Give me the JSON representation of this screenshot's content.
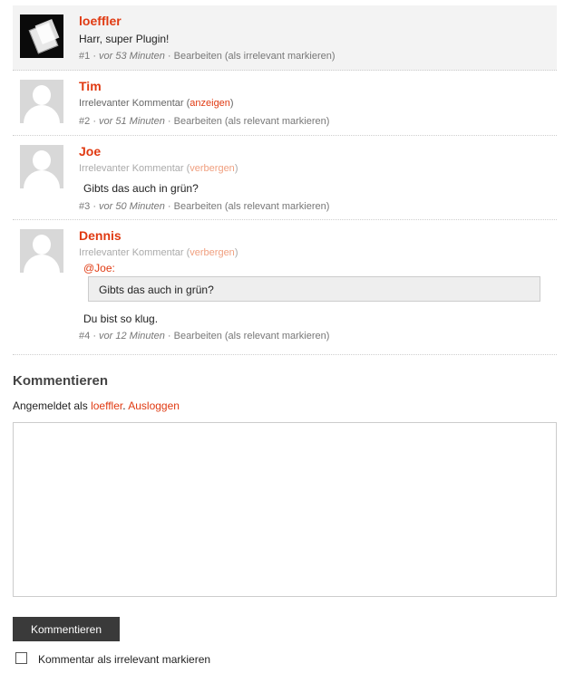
{
  "comments": [
    {
      "author": "loeffler",
      "text": "Harr, super Plugin!",
      "number": "#1",
      "separator": "·",
      "time": "vor 53 Minuten",
      "edit_label": "Bearbeiten",
      "mark_label": "(als irrelevant markieren)"
    },
    {
      "author": "Tim",
      "irrelevant_prefix": "Irrelevanter Kommentar (",
      "irrelevant_toggle": "anzeigen",
      "irrelevant_suffix": ")",
      "number": "#2",
      "separator": "·",
      "time": "vor 51 Minuten",
      "edit_label": "Bearbeiten",
      "mark_label": "(als relevant markieren)"
    },
    {
      "author": "Joe",
      "irrelevant_prefix": "Irrelevanter Kommentar (",
      "irrelevant_toggle": "verbergen",
      "irrelevant_suffix": ")",
      "text": "Gibts das auch in grün?",
      "number": "#3",
      "separator": "·",
      "time": "vor 50 Minuten",
      "edit_label": "Bearbeiten",
      "mark_label": "(als relevant markieren)"
    },
    {
      "author": "Dennis",
      "irrelevant_prefix": "Irrelevanter Kommentar (",
      "irrelevant_toggle": "verbergen",
      "irrelevant_suffix": ")",
      "mention": "@Joe:",
      "quote": "Gibts das auch in grün?",
      "text": "Du bist so klug.",
      "number": "#4",
      "separator": "·",
      "time": "vor 12 Minuten",
      "edit_label": "Bearbeiten",
      "mark_label": "(als relevant markieren)"
    }
  ],
  "reply": {
    "title": "Kommentieren",
    "logged_in_prefix": "Angemeldet als",
    "username": "loeffler",
    "dot": ".",
    "logout": "Ausloggen",
    "textarea_value": "",
    "submit_label": "Kommentieren",
    "checkbox_label": "Kommentar als irrelevant markieren"
  },
  "colors": {
    "accent": "#e03a12",
    "own_comment_bg": "#f3f3f3",
    "button_bg": "#3a3a3a"
  }
}
